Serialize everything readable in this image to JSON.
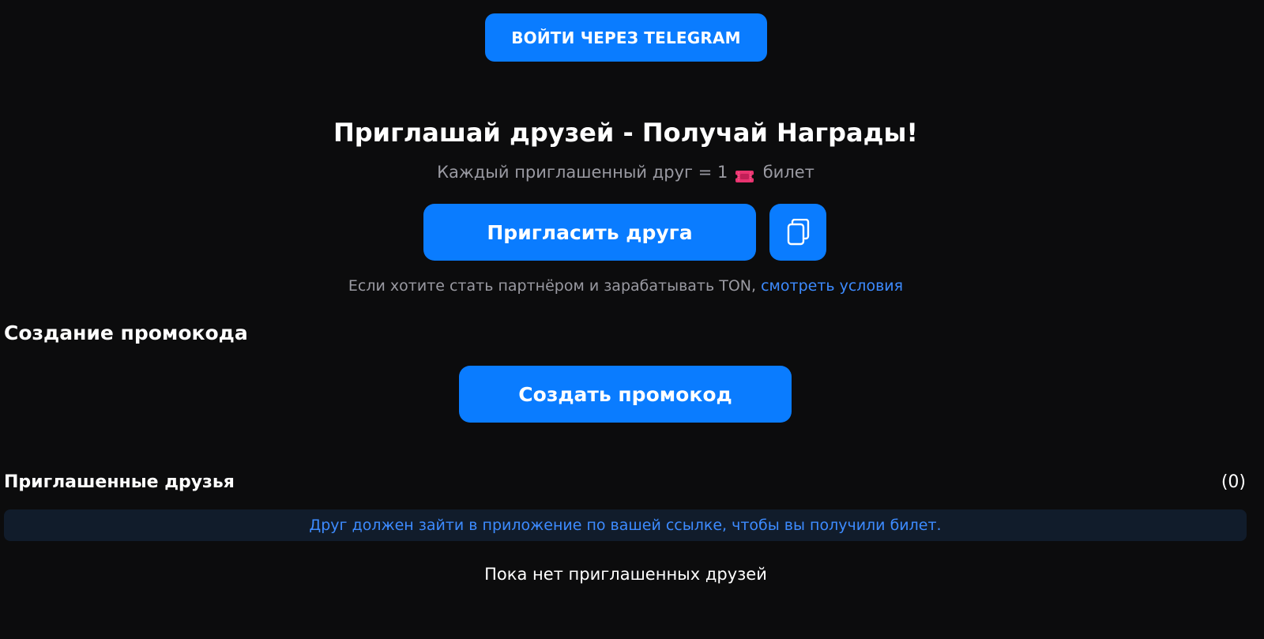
{
  "header": {
    "telegram_login_label": "ВОЙТИ ЧЕРЕЗ TELEGRAM"
  },
  "hero": {
    "title": "Приглашай друзей - Получай Награды!",
    "subtitle_prefix": "Каждый приглашенный друг = 1",
    "subtitle_icon": "ticket-icon",
    "subtitle_suffix": "билет"
  },
  "invite": {
    "invite_button_label": "Пригласить друга",
    "copy_icon": "copy-icon"
  },
  "partner": {
    "text": "Если хотите стать партнёром и зарабатывать TON,",
    "link_label": "смотреть условия"
  },
  "promo": {
    "section_title": "Создание промокода",
    "create_button_label": "Создать промокод"
  },
  "friends": {
    "section_title": "Приглашенные друзья",
    "count": "(0)",
    "info_message": "Друг должен зайти в приложение по вашей ссылке, чтобы вы получили билет.",
    "empty_message": "Пока нет приглашенных друзей"
  },
  "colors": {
    "background": "#0c0c0d",
    "accent": "#0a7cff",
    "link": "#3d8bff",
    "muted_text": "#9a9aa2",
    "info_banner_bg": "#111c2b",
    "ticket": "#e8336f"
  }
}
